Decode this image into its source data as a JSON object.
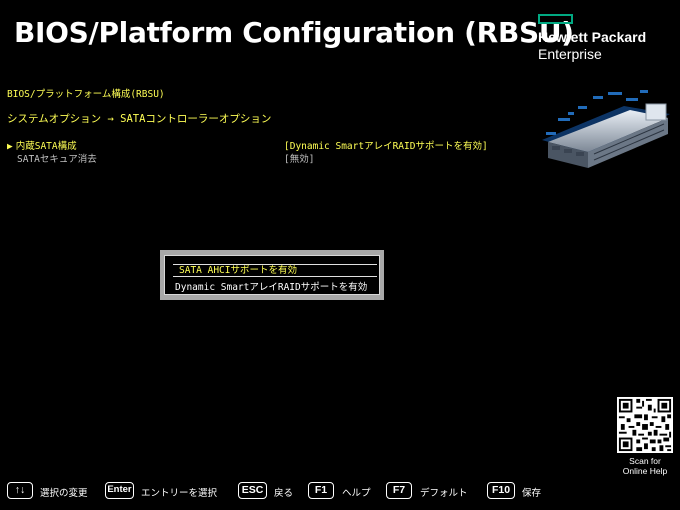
{
  "header": {
    "title": "BIOS/Platform Configuration (RBSU)",
    "brand_line1": "Hewlett Packard",
    "brand_line2": "Enterprise",
    "brand_color": "#01a982"
  },
  "breadcrumb": "BIOS/プラットフォーム構成(RBSU)",
  "section_title": "システムオプション → SATAコントローラーオプション",
  "settings": [
    {
      "label": "内蔵SATA構成",
      "value": "[Dynamic SmartアレイRAIDサポートを有効]",
      "selected": true
    },
    {
      "label": "SATAセキュア消去",
      "value": "[無効]",
      "selected": false
    }
  ],
  "popup": {
    "options": [
      "SATA AHCIサポートを有効",
      "Dynamic SmartアレイRAIDサポートを有効"
    ],
    "highlighted_index": 0
  },
  "qr": {
    "caption_line1": "Scan for",
    "caption_line2": "Online Help"
  },
  "footer": [
    {
      "key": "↑↓",
      "label": "選択の変更",
      "icon": "updown-arrows-icon"
    },
    {
      "key": "Enter",
      "label": "エントリーを選択"
    },
    {
      "key": "ESC",
      "label": "戻る"
    },
    {
      "key": "F1",
      "label": "ヘルプ"
    },
    {
      "key": "F7",
      "label": "デフォルト"
    },
    {
      "key": "F10",
      "label": "保存"
    }
  ],
  "colors": {
    "highlight_text": "#ffff55",
    "background": "#000000",
    "popup_frame": "#a8a8a8"
  }
}
